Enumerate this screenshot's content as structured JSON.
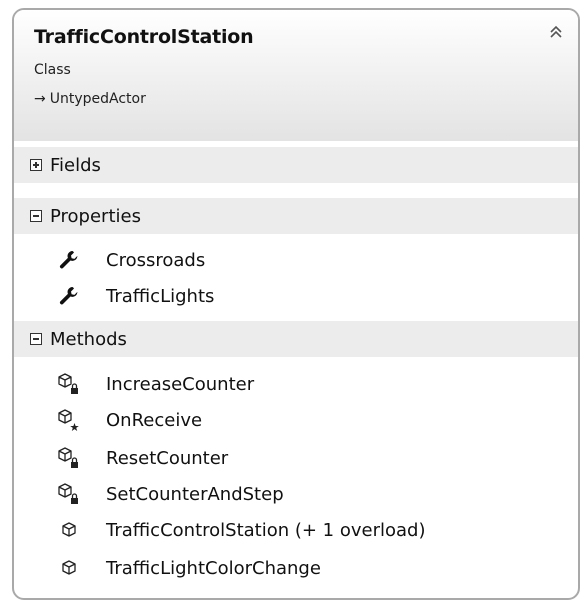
{
  "class": {
    "name": "TrafficControlStation",
    "kind": "Class",
    "base": "UntypedActor"
  },
  "sections": {
    "fields": {
      "label": "Fields",
      "expanded": false
    },
    "properties": {
      "label": "Properties",
      "expanded": true,
      "items": [
        {
          "name": "Crossroads",
          "icon": "wrench-icon"
        },
        {
          "name": "TrafficLights",
          "icon": "wrench-icon"
        }
      ]
    },
    "methods": {
      "label": "Methods",
      "expanded": true,
      "items": [
        {
          "name": "IncreaseCounter",
          "icon": "method-private-icon"
        },
        {
          "name": "OnReceive",
          "icon": "method-protected-icon"
        },
        {
          "name": "ResetCounter",
          "icon": "method-private-icon"
        },
        {
          "name": "SetCounterAndStep",
          "icon": "method-private-icon"
        },
        {
          "name": "TrafficControlStation (+ 1 overload)",
          "icon": "method-public-icon"
        },
        {
          "name": "TrafficLightColorChange",
          "icon": "method-public-icon"
        }
      ]
    }
  },
  "colors": {
    "border": "#a9a9a9",
    "section_bg": "#ececec"
  }
}
